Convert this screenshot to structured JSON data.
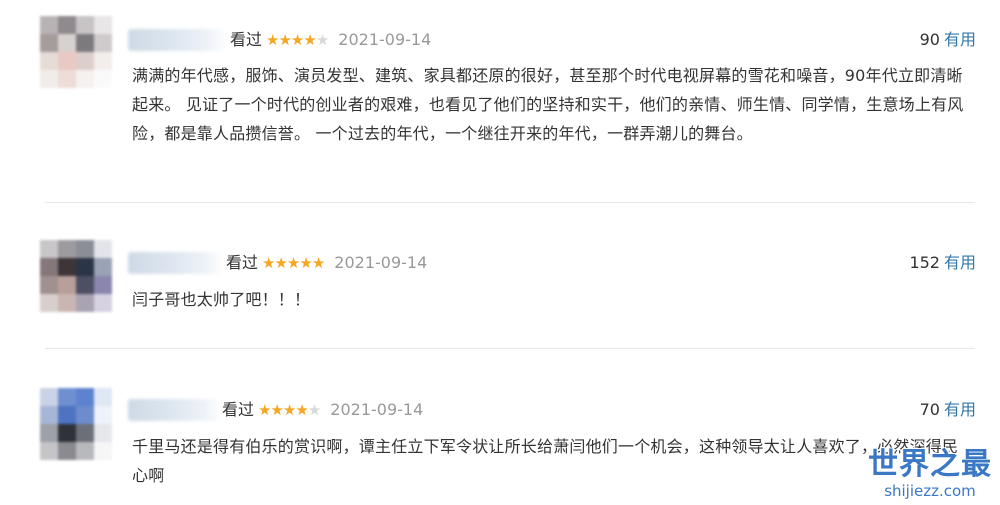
{
  "reviews": [
    {
      "watched_label": "看过",
      "rating_stars": 4,
      "date": "2021-09-14",
      "useful_count": "90",
      "useful_label": "有用",
      "content": "满满的年代感，服饰、演员发型、建筑、家具都还原的很好，甚至那个时代电视屏幕的雪花和噪音，90年代立即清晰起来。 见证了一个时代的创业者的艰难，也看见了他们的坚持和实干，他们的亲情、师生情、同学情，生意场上有风险，都是靠人品攒信誉。 一个过去的年代，一个继往开来的年代，一群弄潮儿的舞台。"
    },
    {
      "watched_label": "看过",
      "rating_stars": 5,
      "date": "2021-09-14",
      "useful_count": "152",
      "useful_label": "有用",
      "content": "闫子哥也太帅了吧！！！"
    },
    {
      "watched_label": "看过",
      "rating_stars": 4,
      "date": "2021-09-14",
      "useful_count": "70",
      "useful_label": "有用",
      "content": "千里马还是得有伯乐的赏识啊，谭主任立下军令状让所长给萧闫他们一个机会，这种领导太让人喜欢了，必然深得民心啊"
    }
  ],
  "watermark": {
    "main": "世界之最",
    "sub": "shijiezz.com"
  },
  "colors": {
    "star_on": "#f5a623",
    "star_off": "#d8d8d8",
    "useful_link": "#3377aa",
    "watermark": "#3a78c6"
  }
}
